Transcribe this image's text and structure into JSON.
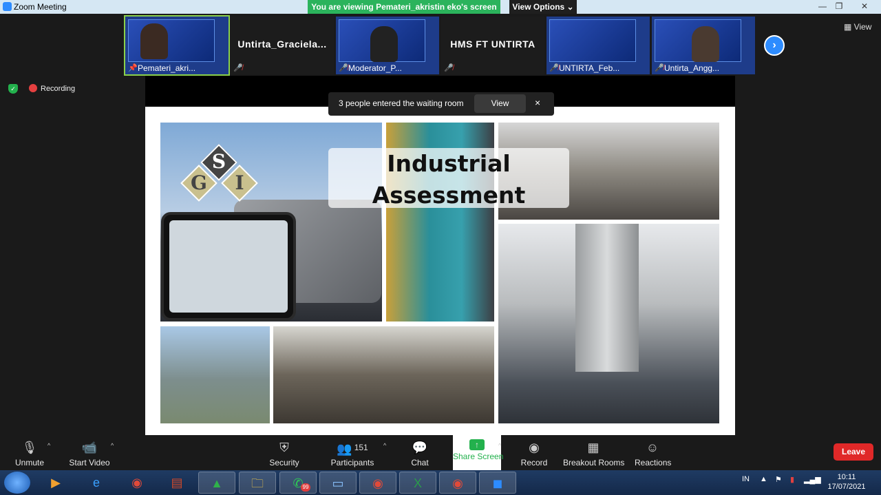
{
  "window": {
    "title": "Zoom Meeting"
  },
  "banner": {
    "viewing": "You are viewing Pemateri_akristin eko's screen",
    "view_options": "View Options ⌄"
  },
  "gallery": {
    "tiles": [
      {
        "name": "Pemateri_akri...",
        "type": "video"
      },
      {
        "name": "Untirta_Graciela...",
        "type": "name"
      },
      {
        "name": "Moderator_P...",
        "type": "video"
      },
      {
        "name": "HMS FT UNTIRTA",
        "type": "name"
      },
      {
        "name": "UNTIRTA_Feb...",
        "type": "video"
      },
      {
        "name": "Untirta_Angg...",
        "type": "video"
      }
    ],
    "view_label": "View"
  },
  "status": {
    "recording": "Recording"
  },
  "waiting_room": {
    "message": "3 people entered the waiting room",
    "view_button": "View",
    "close": "×"
  },
  "slide": {
    "logo_letters": [
      "S",
      "G",
      "I"
    ],
    "title_line1": "Industrial",
    "title_line2": "Assessment"
  },
  "toolbar": {
    "unmute": "Unmute",
    "start_video": "Start Video",
    "security": "Security",
    "participants": "Participants",
    "participants_count": "151",
    "chat": "Chat",
    "share_screen": "Share Screen",
    "record": "Record",
    "breakout_rooms": "Breakout Rooms",
    "reactions": "Reactions",
    "leave": "Leave"
  },
  "taskbar": {
    "whatsapp_badge": "99",
    "language": "IN",
    "time": "10:11",
    "date": "17/07/2021"
  },
  "colors": {
    "accent": "#2d8cff",
    "banner_green": "#2bb35c",
    "leave_red": "#e02828",
    "share_green": "#23b14d"
  }
}
